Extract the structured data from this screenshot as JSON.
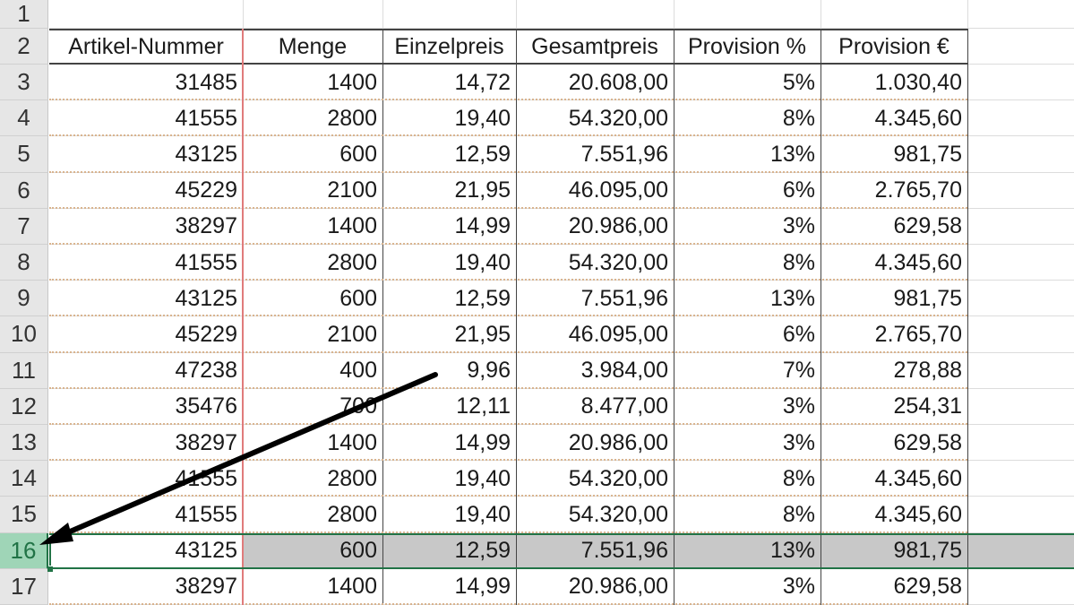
{
  "row_numbers": [
    "1",
    "2",
    "3",
    "4",
    "5",
    "6",
    "7",
    "8",
    "9",
    "10",
    "11",
    "12",
    "13",
    "14",
    "15",
    "16",
    "17"
  ],
  "headers": [
    "Artikel-Nummer",
    "Menge",
    "Einzelpreis",
    "Gesamtpreis",
    "Provision %",
    "Provision €"
  ],
  "rows": [
    [
      "31485",
      "1400",
      "14,72",
      "20.608,00",
      "5%",
      "1.030,40"
    ],
    [
      "41555",
      "2800",
      "19,40",
      "54.320,00",
      "8%",
      "4.345,60"
    ],
    [
      "43125",
      "600",
      "12,59",
      "7.551,96",
      "13%",
      "981,75"
    ],
    [
      "45229",
      "2100",
      "21,95",
      "46.095,00",
      "6%",
      "2.765,70"
    ],
    [
      "38297",
      "1400",
      "14,99",
      "20.986,00",
      "3%",
      "629,58"
    ],
    [
      "41555",
      "2800",
      "19,40",
      "54.320,00",
      "8%",
      "4.345,60"
    ],
    [
      "43125",
      "600",
      "12,59",
      "7.551,96",
      "13%",
      "981,75"
    ],
    [
      "45229",
      "2100",
      "21,95",
      "46.095,00",
      "6%",
      "2.765,70"
    ],
    [
      "47238",
      "400",
      "9,96",
      "3.984,00",
      "7%",
      "278,88"
    ],
    [
      "35476",
      "700",
      "12,11",
      "8.477,00",
      "3%",
      "254,31"
    ],
    [
      "38297",
      "1400",
      "14,99",
      "20.986,00",
      "3%",
      "629,58"
    ],
    [
      "41555",
      "2800",
      "19,40",
      "54.320,00",
      "8%",
      "4.345,60"
    ],
    [
      "41555",
      "2800",
      "19,40",
      "54.320,00",
      "8%",
      "4.345,60"
    ],
    [
      "43125",
      "600",
      "12,59",
      "7.551,96",
      "13%",
      "981,75"
    ],
    [
      "38297",
      "1400",
      "14,99",
      "20.986,00",
      "3%",
      "629,58"
    ]
  ],
  "selected_row": "16",
  "colors": {
    "selection": "#217346",
    "selected_header": "#9fd5b7",
    "selected_fill": "#c8c8c8",
    "dotted_border": "#d9b48f",
    "freeze_line": "#e07b7b"
  },
  "annotation": "arrow-pointing-to-row-16"
}
